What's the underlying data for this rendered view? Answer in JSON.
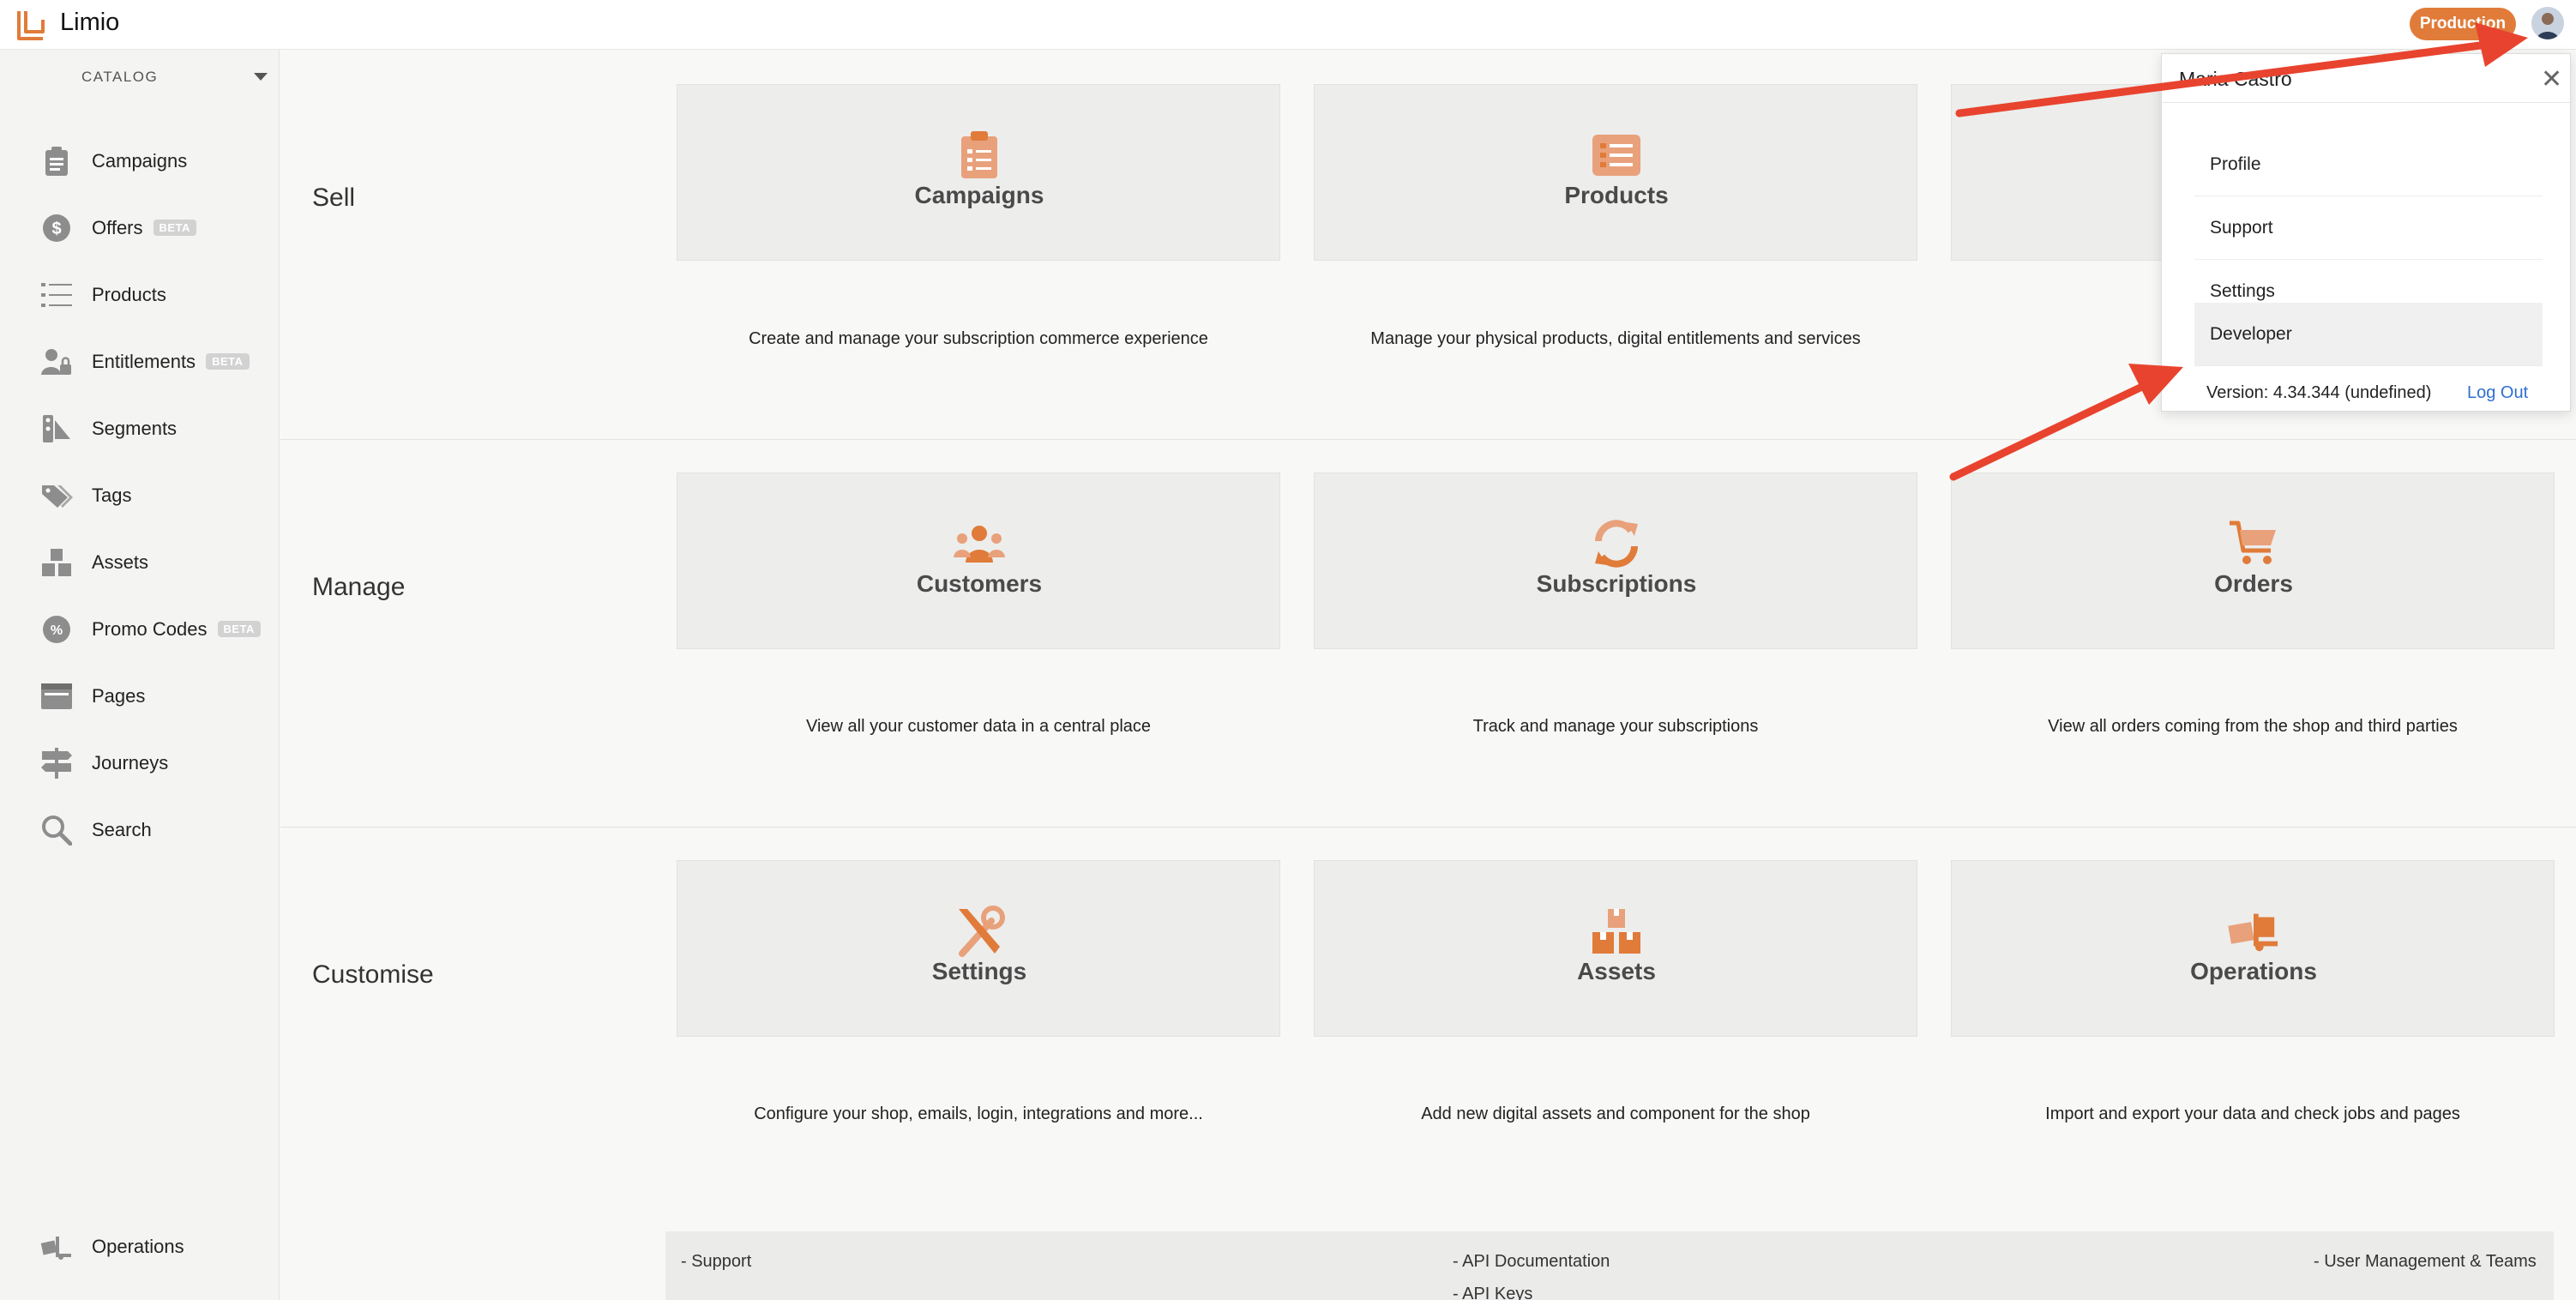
{
  "topbar": {
    "brand": "Limio",
    "environment": "Production",
    "accent_color": "#e07b39"
  },
  "sidebar": {
    "catalog_label": "CATALOG",
    "items": [
      {
        "label": "Campaigns",
        "icon": "clipboard-icon",
        "beta": ""
      },
      {
        "label": "Offers",
        "icon": "dollar-badge-icon",
        "beta": "BETA"
      },
      {
        "label": "Products",
        "icon": "numbered-list-icon",
        "beta": ""
      },
      {
        "label": "Entitlements",
        "icon": "user-lock-icon",
        "beta": "BETA"
      },
      {
        "label": "Segments",
        "icon": "segments-icon",
        "beta": ""
      },
      {
        "label": "Tags",
        "icon": "tags-icon",
        "beta": ""
      },
      {
        "label": "Assets",
        "icon": "boxes-icon",
        "beta": ""
      },
      {
        "label": "Promo Codes",
        "icon": "percent-badge-icon",
        "beta": "BETA"
      },
      {
        "label": "Pages",
        "icon": "page-window-icon",
        "beta": ""
      },
      {
        "label": "Journeys",
        "icon": "signpost-icon",
        "beta": ""
      },
      {
        "label": "Search",
        "icon": "search-icon",
        "beta": ""
      }
    ],
    "bottom_item": {
      "label": "Operations",
      "icon": "operations-icon"
    }
  },
  "sections": [
    {
      "label": "Sell",
      "cards": [
        {
          "title": "Campaigns",
          "description": "Create and manage your subscription commerce experience",
          "icon": "clipboard-icon"
        },
        {
          "title": "Products",
          "description": "Manage your physical products, digital entitlements and services",
          "icon": "list-icon"
        }
      ]
    },
    {
      "label": "Manage",
      "cards": [
        {
          "title": "Customers",
          "description": "View all your customer data in a central place",
          "icon": "users-icon"
        },
        {
          "title": "Subscriptions",
          "description": "Track and manage your subscriptions",
          "icon": "sync-icon"
        },
        {
          "title": "Orders",
          "description": "View all orders coming from the shop and third parties",
          "icon": "cart-icon"
        }
      ]
    },
    {
      "label": "Customise",
      "cards": [
        {
          "title": "Settings",
          "description": "Configure your shop, emails, login, integrations and more...",
          "icon": "tools-icon"
        },
        {
          "title": "Assets",
          "description": "Add new digital assets and component for the shop",
          "icon": "boxes-icon"
        },
        {
          "title": "Operations",
          "description": "Import and export your data and check jobs and pages",
          "icon": "dolly-icon"
        }
      ]
    }
  ],
  "footer": {
    "links": [
      "- Support",
      "- API Documentation",
      "- API Keys",
      "- User Management & Teams"
    ]
  },
  "user_menu": {
    "user_name": "Maria Castro",
    "items": [
      "Profile",
      "Support",
      "Settings",
      "Developer"
    ],
    "active_item": "Developer",
    "version": "Version: 4.34.344 (undefined)",
    "logout": "Log Out"
  }
}
